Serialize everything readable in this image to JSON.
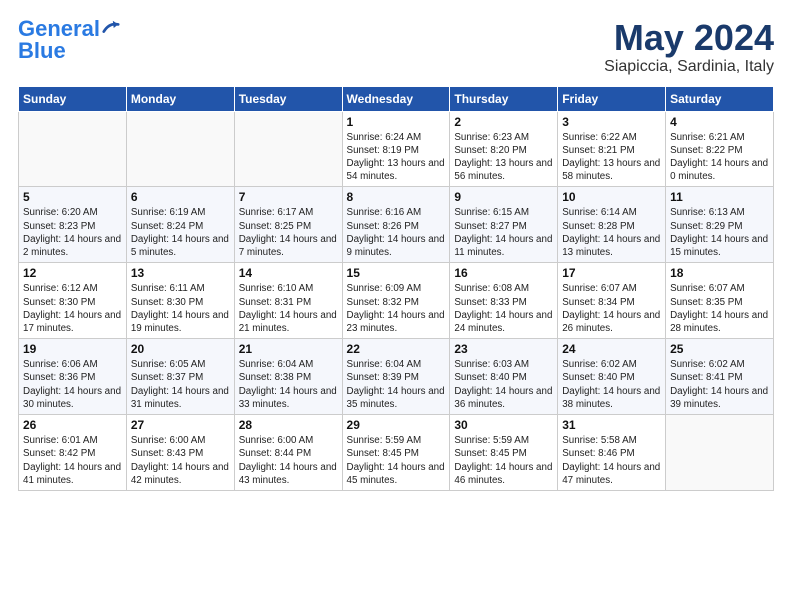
{
  "header": {
    "logo_line1": "General",
    "logo_line2": "Blue",
    "title": "May 2024",
    "subtitle": "Siapiccia, Sardinia, Italy"
  },
  "weekdays": [
    "Sunday",
    "Monday",
    "Tuesday",
    "Wednesday",
    "Thursday",
    "Friday",
    "Saturday"
  ],
  "weeks": [
    [
      {
        "day": "",
        "sunrise": "",
        "sunset": "",
        "daylight": ""
      },
      {
        "day": "",
        "sunrise": "",
        "sunset": "",
        "daylight": ""
      },
      {
        "day": "",
        "sunrise": "",
        "sunset": "",
        "daylight": ""
      },
      {
        "day": "1",
        "sunrise": "Sunrise: 6:24 AM",
        "sunset": "Sunset: 8:19 PM",
        "daylight": "Daylight: 13 hours and 54 minutes."
      },
      {
        "day": "2",
        "sunrise": "Sunrise: 6:23 AM",
        "sunset": "Sunset: 8:20 PM",
        "daylight": "Daylight: 13 hours and 56 minutes."
      },
      {
        "day": "3",
        "sunrise": "Sunrise: 6:22 AM",
        "sunset": "Sunset: 8:21 PM",
        "daylight": "Daylight: 13 hours and 58 minutes."
      },
      {
        "day": "4",
        "sunrise": "Sunrise: 6:21 AM",
        "sunset": "Sunset: 8:22 PM",
        "daylight": "Daylight: 14 hours and 0 minutes."
      }
    ],
    [
      {
        "day": "5",
        "sunrise": "Sunrise: 6:20 AM",
        "sunset": "Sunset: 8:23 PM",
        "daylight": "Daylight: 14 hours and 2 minutes."
      },
      {
        "day": "6",
        "sunrise": "Sunrise: 6:19 AM",
        "sunset": "Sunset: 8:24 PM",
        "daylight": "Daylight: 14 hours and 5 minutes."
      },
      {
        "day": "7",
        "sunrise": "Sunrise: 6:17 AM",
        "sunset": "Sunset: 8:25 PM",
        "daylight": "Daylight: 14 hours and 7 minutes."
      },
      {
        "day": "8",
        "sunrise": "Sunrise: 6:16 AM",
        "sunset": "Sunset: 8:26 PM",
        "daylight": "Daylight: 14 hours and 9 minutes."
      },
      {
        "day": "9",
        "sunrise": "Sunrise: 6:15 AM",
        "sunset": "Sunset: 8:27 PM",
        "daylight": "Daylight: 14 hours and 11 minutes."
      },
      {
        "day": "10",
        "sunrise": "Sunrise: 6:14 AM",
        "sunset": "Sunset: 8:28 PM",
        "daylight": "Daylight: 14 hours and 13 minutes."
      },
      {
        "day": "11",
        "sunrise": "Sunrise: 6:13 AM",
        "sunset": "Sunset: 8:29 PM",
        "daylight": "Daylight: 14 hours and 15 minutes."
      }
    ],
    [
      {
        "day": "12",
        "sunrise": "Sunrise: 6:12 AM",
        "sunset": "Sunset: 8:30 PM",
        "daylight": "Daylight: 14 hours and 17 minutes."
      },
      {
        "day": "13",
        "sunrise": "Sunrise: 6:11 AM",
        "sunset": "Sunset: 8:30 PM",
        "daylight": "Daylight: 14 hours and 19 minutes."
      },
      {
        "day": "14",
        "sunrise": "Sunrise: 6:10 AM",
        "sunset": "Sunset: 8:31 PM",
        "daylight": "Daylight: 14 hours and 21 minutes."
      },
      {
        "day": "15",
        "sunrise": "Sunrise: 6:09 AM",
        "sunset": "Sunset: 8:32 PM",
        "daylight": "Daylight: 14 hours and 23 minutes."
      },
      {
        "day": "16",
        "sunrise": "Sunrise: 6:08 AM",
        "sunset": "Sunset: 8:33 PM",
        "daylight": "Daylight: 14 hours and 24 minutes."
      },
      {
        "day": "17",
        "sunrise": "Sunrise: 6:07 AM",
        "sunset": "Sunset: 8:34 PM",
        "daylight": "Daylight: 14 hours and 26 minutes."
      },
      {
        "day": "18",
        "sunrise": "Sunrise: 6:07 AM",
        "sunset": "Sunset: 8:35 PM",
        "daylight": "Daylight: 14 hours and 28 minutes."
      }
    ],
    [
      {
        "day": "19",
        "sunrise": "Sunrise: 6:06 AM",
        "sunset": "Sunset: 8:36 PM",
        "daylight": "Daylight: 14 hours and 30 minutes."
      },
      {
        "day": "20",
        "sunrise": "Sunrise: 6:05 AM",
        "sunset": "Sunset: 8:37 PM",
        "daylight": "Daylight: 14 hours and 31 minutes."
      },
      {
        "day": "21",
        "sunrise": "Sunrise: 6:04 AM",
        "sunset": "Sunset: 8:38 PM",
        "daylight": "Daylight: 14 hours and 33 minutes."
      },
      {
        "day": "22",
        "sunrise": "Sunrise: 6:04 AM",
        "sunset": "Sunset: 8:39 PM",
        "daylight": "Daylight: 14 hours and 35 minutes."
      },
      {
        "day": "23",
        "sunrise": "Sunrise: 6:03 AM",
        "sunset": "Sunset: 8:40 PM",
        "daylight": "Daylight: 14 hours and 36 minutes."
      },
      {
        "day": "24",
        "sunrise": "Sunrise: 6:02 AM",
        "sunset": "Sunset: 8:40 PM",
        "daylight": "Daylight: 14 hours and 38 minutes."
      },
      {
        "day": "25",
        "sunrise": "Sunrise: 6:02 AM",
        "sunset": "Sunset: 8:41 PM",
        "daylight": "Daylight: 14 hours and 39 minutes."
      }
    ],
    [
      {
        "day": "26",
        "sunrise": "Sunrise: 6:01 AM",
        "sunset": "Sunset: 8:42 PM",
        "daylight": "Daylight: 14 hours and 41 minutes."
      },
      {
        "day": "27",
        "sunrise": "Sunrise: 6:00 AM",
        "sunset": "Sunset: 8:43 PM",
        "daylight": "Daylight: 14 hours and 42 minutes."
      },
      {
        "day": "28",
        "sunrise": "Sunrise: 6:00 AM",
        "sunset": "Sunset: 8:44 PM",
        "daylight": "Daylight: 14 hours and 43 minutes."
      },
      {
        "day": "29",
        "sunrise": "Sunrise: 5:59 AM",
        "sunset": "Sunset: 8:45 PM",
        "daylight": "Daylight: 14 hours and 45 minutes."
      },
      {
        "day": "30",
        "sunrise": "Sunrise: 5:59 AM",
        "sunset": "Sunset: 8:45 PM",
        "daylight": "Daylight: 14 hours and 46 minutes."
      },
      {
        "day": "31",
        "sunrise": "Sunrise: 5:58 AM",
        "sunset": "Sunset: 8:46 PM",
        "daylight": "Daylight: 14 hours and 47 minutes."
      },
      {
        "day": "",
        "sunrise": "",
        "sunset": "",
        "daylight": ""
      }
    ]
  ]
}
